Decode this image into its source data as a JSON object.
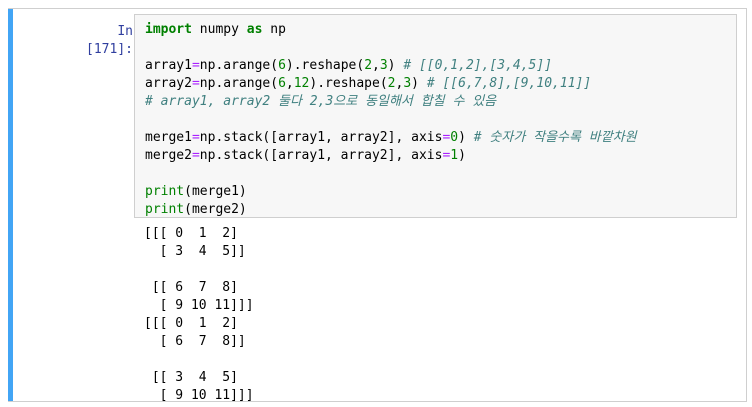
{
  "cell": {
    "prompt": "In [171]:",
    "code_lines": [
      [
        {
          "t": "kw",
          "v": "import"
        },
        {
          "t": "p",
          "v": " numpy "
        },
        {
          "t": "kw",
          "v": "as"
        },
        {
          "t": "p",
          "v": " np"
        }
      ],
      [],
      [
        {
          "t": "p",
          "v": "array1"
        },
        {
          "t": "op",
          "v": "="
        },
        {
          "t": "p",
          "v": "np.arange("
        },
        {
          "t": "num",
          "v": "6"
        },
        {
          "t": "p",
          "v": ").reshape("
        },
        {
          "t": "num",
          "v": "2"
        },
        {
          "t": "p",
          "v": ","
        },
        {
          "t": "num",
          "v": "3"
        },
        {
          "t": "p",
          "v": ") "
        },
        {
          "t": "cm",
          "v": "# [[0,1,2],[3,4,5]]"
        }
      ],
      [
        {
          "t": "p",
          "v": "array2"
        },
        {
          "t": "op",
          "v": "="
        },
        {
          "t": "p",
          "v": "np.arange("
        },
        {
          "t": "num",
          "v": "6"
        },
        {
          "t": "p",
          "v": ","
        },
        {
          "t": "num",
          "v": "12"
        },
        {
          "t": "p",
          "v": ").reshape("
        },
        {
          "t": "num",
          "v": "2"
        },
        {
          "t": "p",
          "v": ","
        },
        {
          "t": "num",
          "v": "3"
        },
        {
          "t": "p",
          "v": ") "
        },
        {
          "t": "cm",
          "v": "# [[6,7,8],[9,10,11]]"
        }
      ],
      [
        {
          "t": "cm",
          "v": "# array1, array2 둘다 2,3으로 동일해서 합칠 수 있음"
        }
      ],
      [],
      [
        {
          "t": "p",
          "v": "merge1"
        },
        {
          "t": "op",
          "v": "="
        },
        {
          "t": "p",
          "v": "np.stack([array1, array2], axis"
        },
        {
          "t": "op",
          "v": "="
        },
        {
          "t": "num",
          "v": "0"
        },
        {
          "t": "p",
          "v": ") "
        },
        {
          "t": "cm",
          "v": "# 숫자가 작을수록 바깥차원"
        }
      ],
      [
        {
          "t": "p",
          "v": "merge2"
        },
        {
          "t": "op",
          "v": "="
        },
        {
          "t": "p",
          "v": "np.stack([array1, array2], axis"
        },
        {
          "t": "op",
          "v": "="
        },
        {
          "t": "num",
          "v": "1"
        },
        {
          "t": "p",
          "v": ")"
        }
      ],
      [],
      [
        {
          "t": "kwp",
          "v": "print"
        },
        {
          "t": "p",
          "v": "(merge1)"
        }
      ],
      [
        {
          "t": "kwp",
          "v": "print"
        },
        {
          "t": "p",
          "v": "(merge2)"
        }
      ]
    ],
    "output_lines": [
      "[[[ 0  1  2]",
      "  [ 3  4  5]]",
      "",
      " [[ 6  7  8]",
      "  [ 9 10 11]]]",
      "[[[ 0  1  2]",
      "  [ 6  7  8]]",
      "",
      " [[ 3  4  5]",
      "  [ 9 10 11]]]"
    ]
  }
}
